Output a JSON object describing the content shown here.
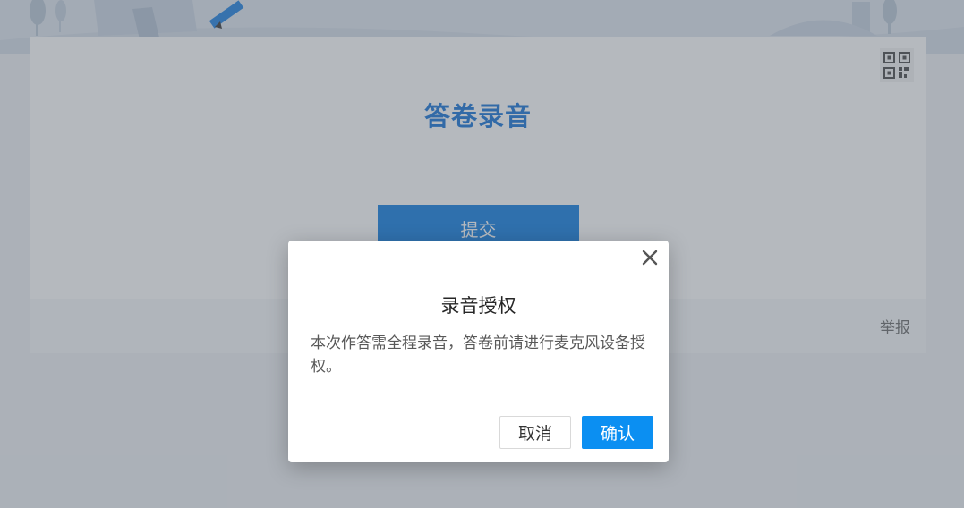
{
  "survey": {
    "title": "答卷录音",
    "submit_label": "提交",
    "report_label": "举报",
    "qr_icon": "qr-code-icon"
  },
  "dialog": {
    "title": "录音授权",
    "message": "本次作答需全程录音，答卷前请进行麦克风设备授权。",
    "cancel_label": "取消",
    "confirm_label": "确认",
    "close_icon": "close-icon"
  },
  "colors": {
    "title_blue": "#1170d6",
    "submit_blue": "#0b7ae0",
    "confirm_blue": "#0b8ff2"
  }
}
